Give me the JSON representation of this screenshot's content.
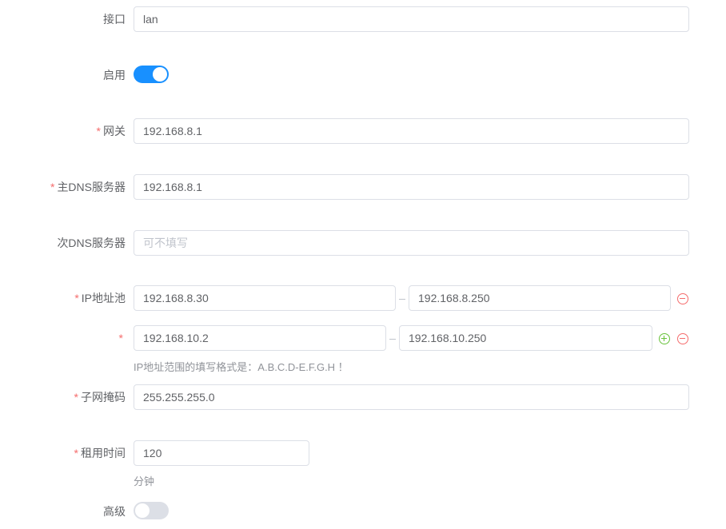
{
  "interface": {
    "label": "接口",
    "value": "lan"
  },
  "enable": {
    "label": "启用",
    "state": "on",
    "accent": "#1890ff"
  },
  "gateway": {
    "required_mark": "*",
    "label": "网关",
    "value": "192.168.8.1"
  },
  "primary_dns": {
    "required_mark": "*",
    "label": "主DNS服务器",
    "value": "192.168.8.1"
  },
  "secondary_dns": {
    "label": "次DNS服务器",
    "value": "",
    "placeholder": "可不填写"
  },
  "ip_pool": {
    "required_mark": "*",
    "label": "IP地址池",
    "separator": "-",
    "ranges": [
      {
        "start": "192.168.8.30",
        "end": "192.168.8.250"
      },
      {
        "start": "192.168.10.2",
        "end": "192.168.10.250"
      }
    ],
    "hint": "IP地址范围的填写格式是：A.B.C.D-E.F.G.H ！"
  },
  "subnet_mask": {
    "required_mark": "*",
    "label": "子网掩码",
    "value": "255.255.255.0"
  },
  "lease_time": {
    "required_mark": "*",
    "label": "租用时间",
    "value": "120",
    "unit": "分钟"
  },
  "advanced": {
    "label": "高级",
    "state": "off"
  },
  "colors": {
    "required": "#f56c6c",
    "add": "#67c23a",
    "remove": "#f56c6c",
    "border": "#dcdfe6"
  },
  "icons": {
    "remove": "minus-circle-icon",
    "add": "plus-circle-icon"
  }
}
